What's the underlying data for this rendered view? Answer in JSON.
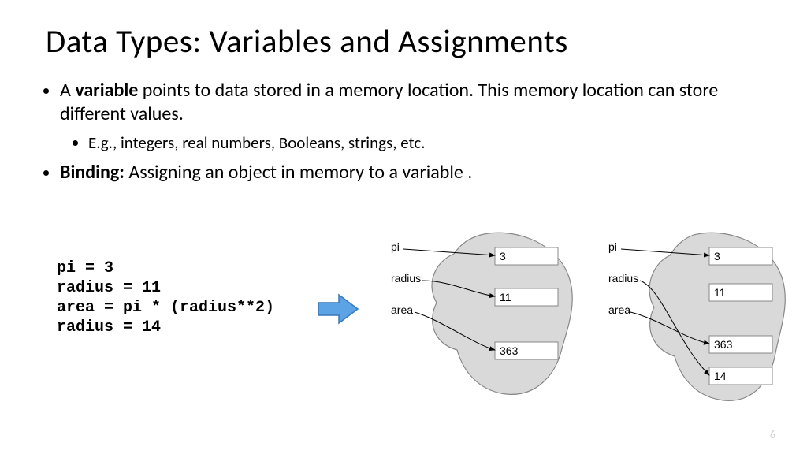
{
  "title": "Data Types: Variables and Assignments",
  "bullets": {
    "b1_pre": "A ",
    "b1_bold": "variable",
    "b1_post": " points to data stored in a memory location. This memory location can store different values.",
    "b1_sub": "E.g., integers, real numbers, Booleans, strings, etc.",
    "b2_bold": "Binding:",
    "b2_post": " Assigning an object in memory to a variable ."
  },
  "code": {
    "l1": "pi = 3",
    "l2": "radius = 11",
    "l3": "area = pi * (radius**2)",
    "l4": "radius = 14"
  },
  "diagram": {
    "labels": {
      "pi": "pi",
      "radius": "radius",
      "area": "area"
    },
    "left": {
      "v1": "3",
      "v2": "11",
      "v3": "363"
    },
    "right": {
      "v1": "3",
      "v2": "11",
      "v3": "363",
      "v4": "14"
    }
  },
  "page": "6"
}
